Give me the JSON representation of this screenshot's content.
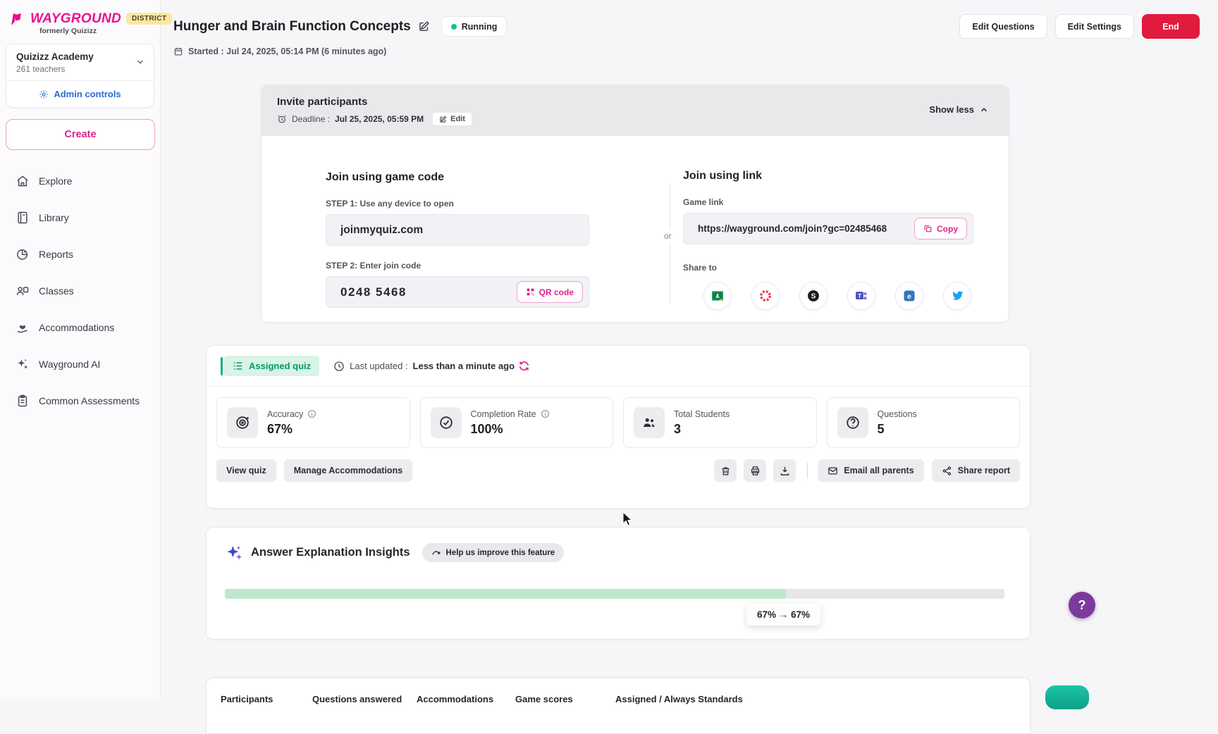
{
  "colors": {
    "brand_pink": "#ed0e8c",
    "accent_pink": "#e0218a",
    "end_red": "#e11b3d",
    "success_green": "#00b36f",
    "running_dot": "#00c985",
    "admin_blue": "#2b6cd4",
    "help_purple": "#7d3a9d",
    "district_yellow": "#fbe7a3",
    "progress_green": "#bde7cb"
  },
  "brand": {
    "logo": "WAYGROUND",
    "tagline": "formerly Quizizz",
    "district": "DISTRICT"
  },
  "org": {
    "name": "Quizizz Academy",
    "teachers": "261 teachers",
    "admin": "Admin controls"
  },
  "sidebar": {
    "create": "Create",
    "items": [
      {
        "icon": "home-icon",
        "label": "Explore"
      },
      {
        "icon": "library-icon",
        "label": "Library"
      },
      {
        "icon": "reports-icon",
        "label": "Reports"
      },
      {
        "icon": "classes-icon",
        "label": "Classes"
      },
      {
        "icon": "accommodations-icon",
        "label": "Accommodations"
      },
      {
        "icon": "sparkles-icon",
        "label": "Wayground AI"
      },
      {
        "icon": "assessments-icon",
        "label": "Common Assessments"
      }
    ]
  },
  "header": {
    "title": "Hunger and Brain Function Concepts",
    "status": "Running",
    "started": "Started : Jul 24, 2025, 05:14 PM (6 minutes ago)",
    "edit_questions": "Edit Questions",
    "edit_settings": "Edit Settings",
    "end": "End"
  },
  "invite": {
    "title": "Invite participants",
    "deadline_label": "Deadline :",
    "deadline_value": "Jul 25, 2025, 05:59 PM",
    "edit": "Edit",
    "show_less": "Show less",
    "or": "or",
    "game_code": {
      "heading": "Join using game code",
      "step1": "STEP 1: Use any device to open",
      "domain": "joinmyquiz.com",
      "step2": "STEP 2: Enter join code",
      "code": "0248 5468",
      "qr": "QR code"
    },
    "link": {
      "heading": "Join using link",
      "label": "Game link",
      "url": "https://wayground.com/join?gc=02485468",
      "copy": "Copy",
      "share_to": "Share to",
      "share_options": [
        "google-classroom",
        "seesaw",
        "schoology",
        "microsoft-teams",
        "edmodo",
        "twitter"
      ]
    }
  },
  "report": {
    "badge": "Assigned quiz",
    "last_updated_label": "Last updated :",
    "last_updated_value": "Less than a minute ago",
    "stats": [
      {
        "icon": "accuracy-target-icon",
        "label": "Accuracy",
        "value": "67%"
      },
      {
        "icon": "completion-check-icon",
        "label": "Completion Rate",
        "value": "100%"
      },
      {
        "icon": "students-icon",
        "label": "Total Students",
        "value": "3"
      },
      {
        "icon": "questions-icon",
        "label": "Questions",
        "value": "5"
      }
    ],
    "view_quiz": "View quiz",
    "manage_accommodations": "Manage Accommodations",
    "email_all_parents": "Email all parents",
    "share_report": "Share report"
  },
  "insights": {
    "title": "Answer Explanation Insights",
    "improve": "Help us improve this feature",
    "progress_label": "67% → 67%",
    "progress_fill_pct": 72
  },
  "table": {
    "headers": [
      "Participants",
      "Questions answered",
      "Accommodations",
      "Game scores",
      "Assigned / Always Standards"
    ]
  },
  "fab": {
    "help": "?"
  }
}
